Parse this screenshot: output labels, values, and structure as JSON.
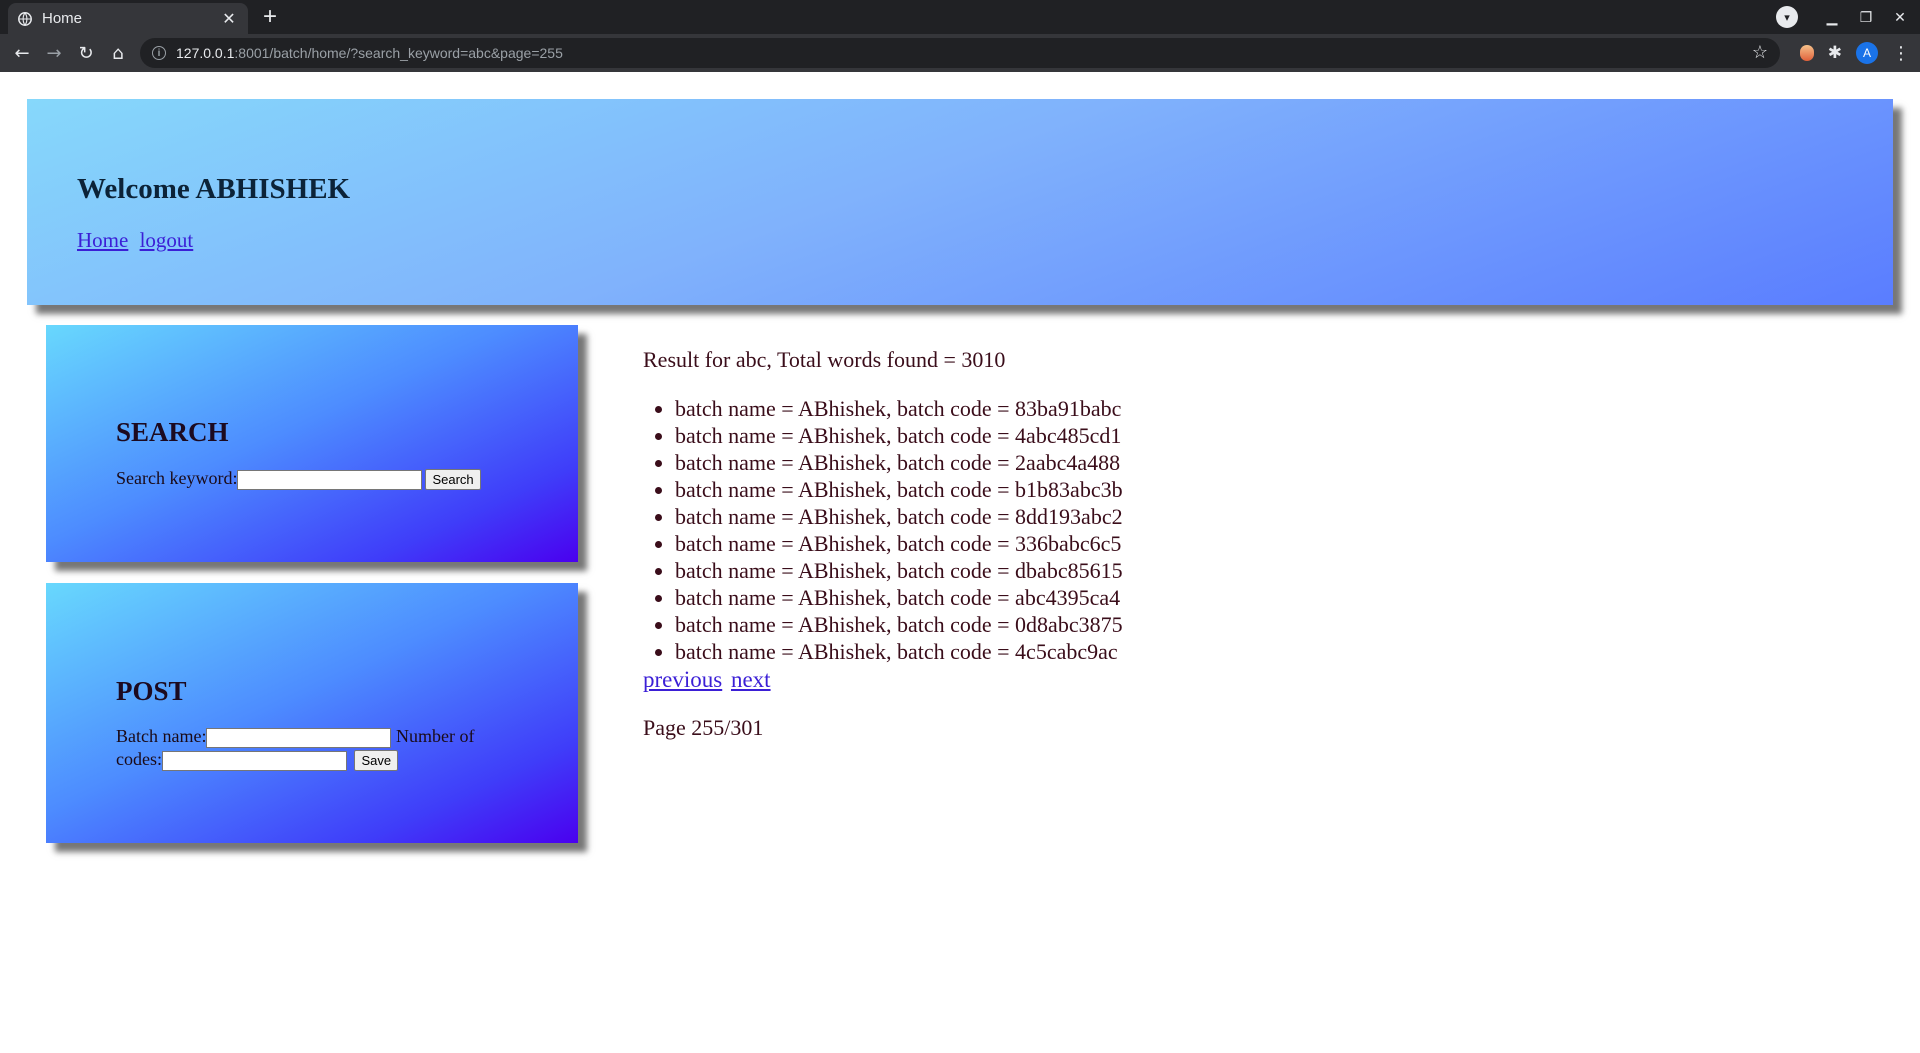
{
  "browser": {
    "tab_title": "Home",
    "new_tab_symbol": "+",
    "url_host": "127.0.0.1",
    "url_rest": ":8001/batch/home/?search_keyword=abc&page=255",
    "profile_initial": "A"
  },
  "header": {
    "welcome": "Welcome ABHISHEK",
    "links": [
      "Home",
      "logout"
    ]
  },
  "search_panel": {
    "title": "SEARCH",
    "keyword_label": "Search keyword:",
    "keyword_value": "",
    "button_label": "Search"
  },
  "post_panel": {
    "title": "POST",
    "batch_name_label": "Batch name:",
    "batch_name_value": "",
    "codes_label": "Number of codes:",
    "codes_value": "",
    "button_label": "Save"
  },
  "results": {
    "summary": "Result for abc, Total words found = 3010",
    "items": [
      "batch name = ABhishek, batch code = 83ba91babc",
      "batch name = ABhishek, batch code = 4abc485cd1",
      "batch name = ABhishek, batch code = 2aabc4a488",
      "batch name = ABhishek, batch code = b1b83abc3b",
      "batch name = ABhishek, batch code = 8dd193abc2",
      "batch name = ABhishek, batch code = 336babc6c5",
      "batch name = ABhishek, batch code = dbabc85615",
      "batch name = ABhishek, batch code = abc4395ca4",
      "batch name = ABhishek, batch code = 0d8abc3875",
      "batch name = ABhishek, batch code = 4c5cabc9ac"
    ],
    "previous_label": "previous",
    "next_label": "next",
    "page_info": "Page 255/301"
  }
}
